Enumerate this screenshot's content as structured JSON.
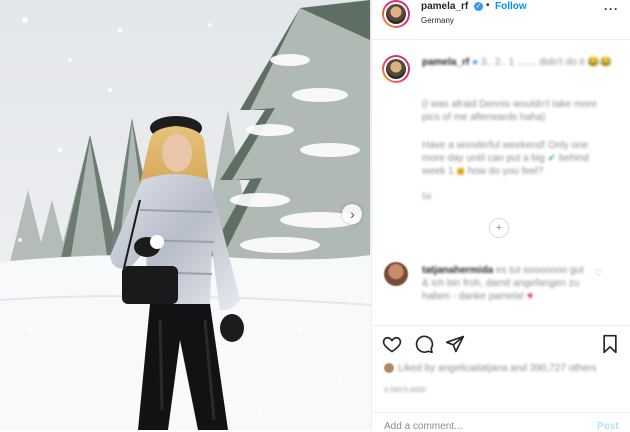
{
  "post": {
    "username": "pamela_rf",
    "verified_icon": "verified-badge-icon",
    "separator": "•",
    "follow_label": "Follow",
    "location": "Germany",
    "more_icon": "more-options-icon"
  },
  "caption": {
    "username": "pamela_rf",
    "line1": "3.. 2.. 1 ....... didn't do it",
    "emoji1": "😂😂",
    "para1": "(I was afraid Dennis wouldn't take more pics of me afterwards haha)",
    "para2_a": "Have a wonderful weekend! Only one more day until can put a big",
    "para2_b": "behind week 1",
    "para2_c": "how do you feel?",
    "time": "5d"
  },
  "comment": {
    "username": "tatjanahermida",
    "text": "es tut sooooooo gut & ich bin froh, damit angefangen zu haben - danke pamela!",
    "heart": "♥"
  },
  "actions": {
    "icons": [
      "like-heart-icon",
      "comment-icon",
      "share-icon",
      "save-bookmark-icon"
    ],
    "likes_text": "Liked by angelicaitatjana and 390,727 others",
    "time_ago": "4 DAYS AGO"
  },
  "add_comment": {
    "placeholder": "Add a comment...",
    "post_label": "Post"
  },
  "colors": {
    "link_blue": "#0095f6",
    "post_disabled": "#b2dffc",
    "border": "#efefef",
    "text": "#262626",
    "muted": "#8e8e8e"
  }
}
